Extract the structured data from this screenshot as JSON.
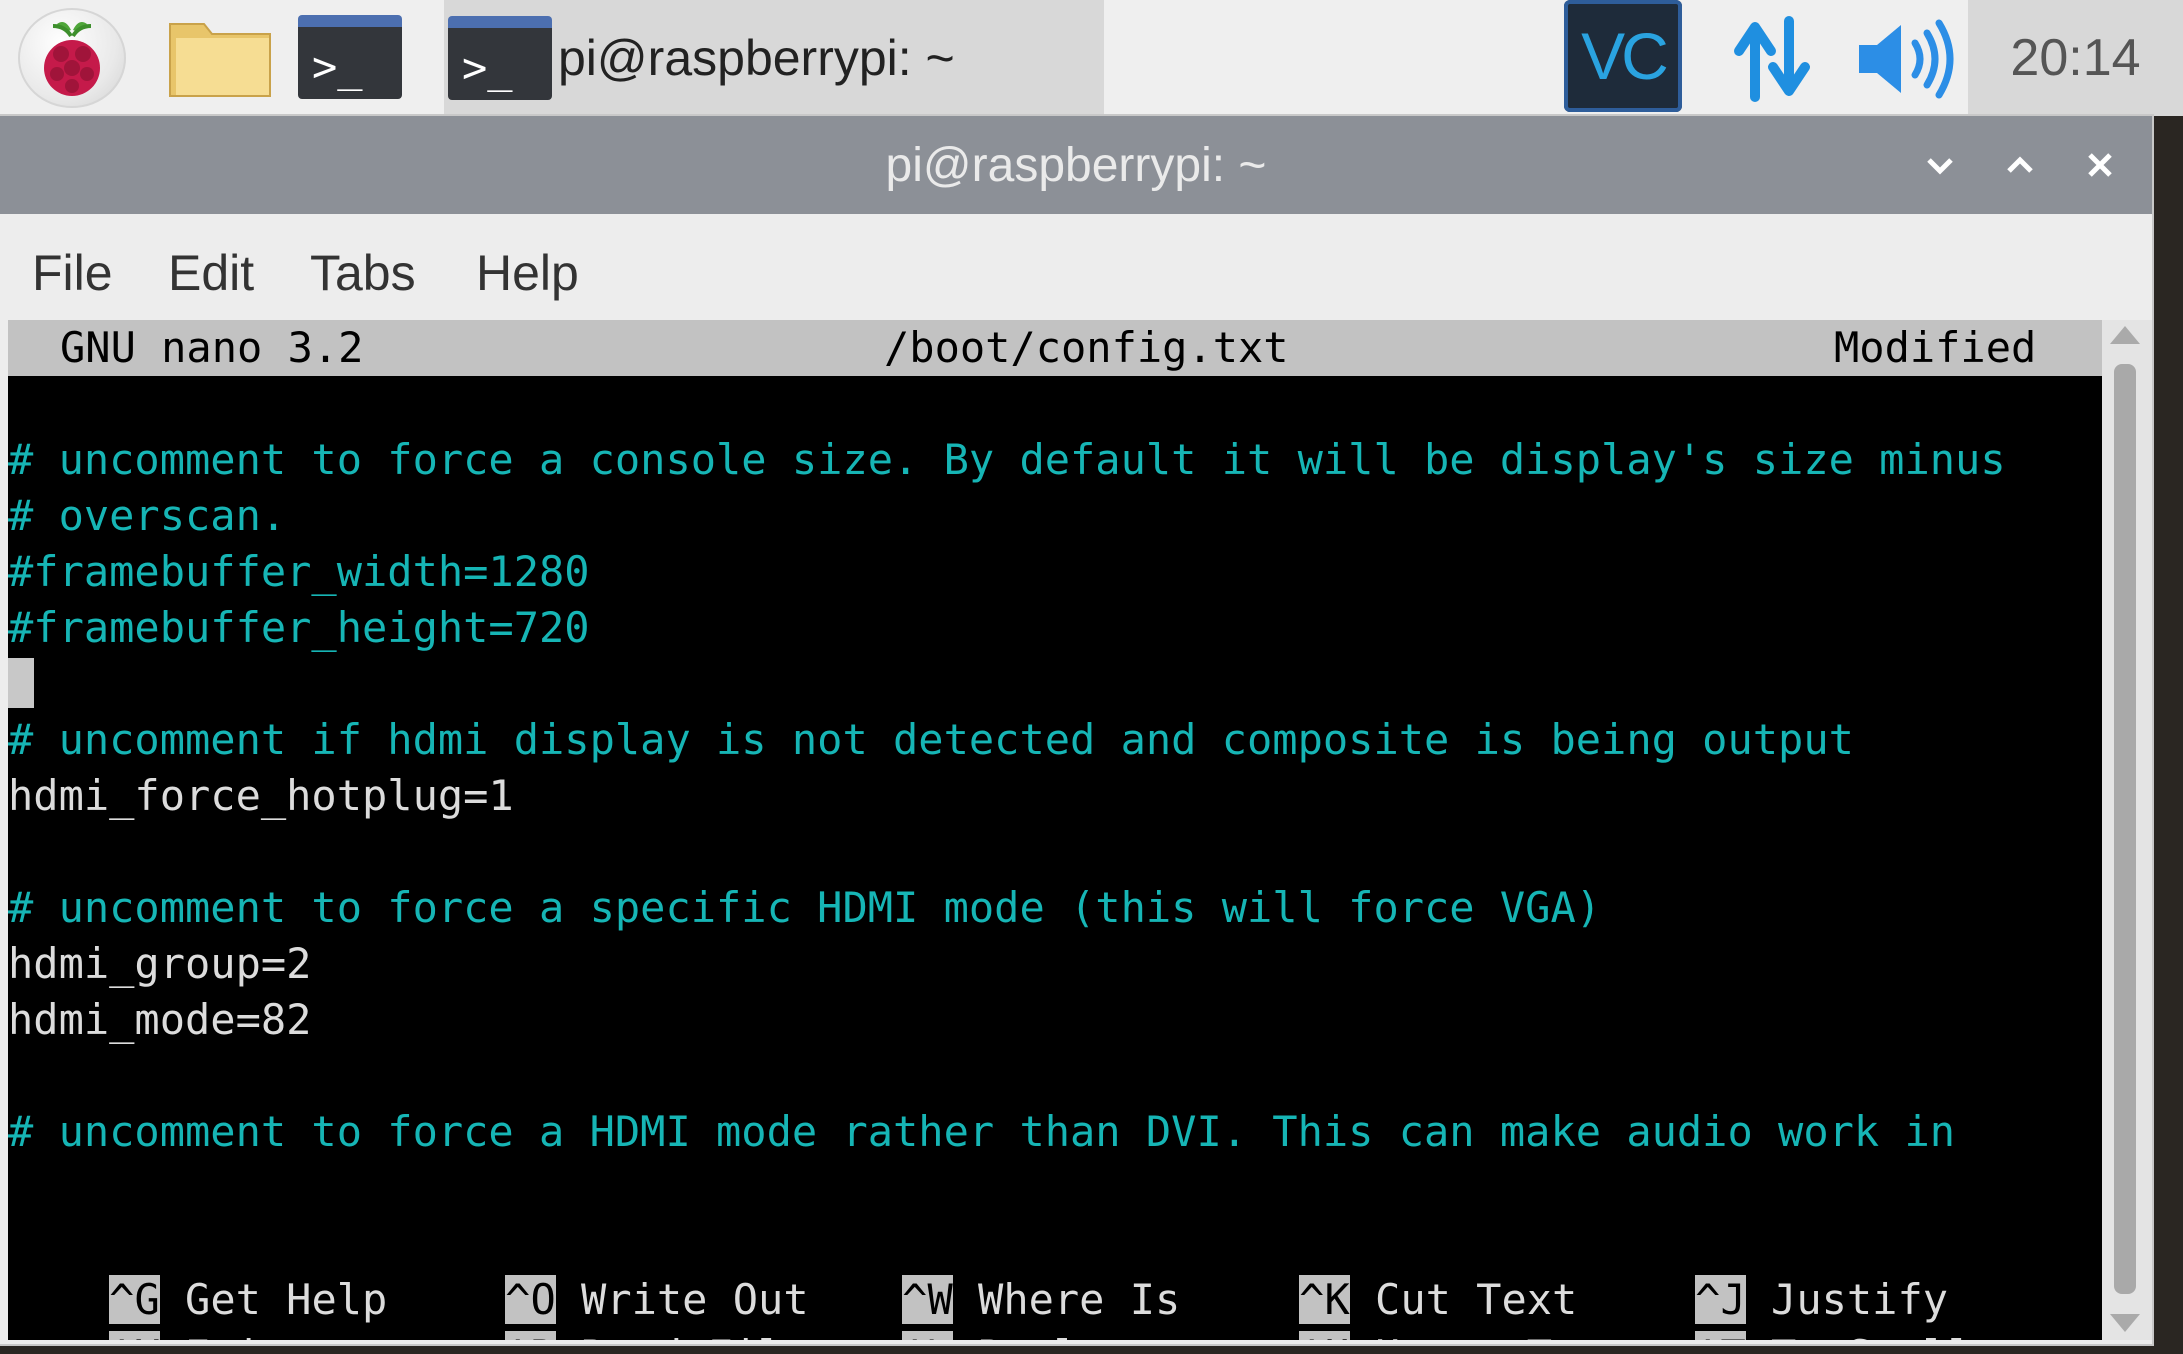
{
  "panel": {
    "icons": [
      "raspberry-menu-icon",
      "file-manager-icon",
      "terminal-icon",
      "vnc-icon",
      "network-icon",
      "volume-icon"
    ],
    "task_button_label": "pi@raspberrypi: ~",
    "terminal_icon_glyph": ">_",
    "vnc_glyph": "VC",
    "clock": "20:14"
  },
  "window": {
    "title": "pi@raspberrypi: ~",
    "menu": [
      "File",
      "Edit",
      "Tabs",
      "Help"
    ]
  },
  "nano": {
    "version": "GNU nano 3.2",
    "filename": "/boot/config.txt",
    "status": "Modified",
    "lines": [
      "# uncomment to force a console size. By default it will be display's size minus",
      "# overscan.",
      "#framebuffer_width=1280",
      "#framebuffer_height=720",
      "",
      "# uncomment if hdmi display is not detected and composite is being output",
      "hdmi_force_hotplug=1",
      "",
      "# uncomment to force a specific HDMI mode (this will force VGA)",
      "hdmi_group=2",
      "hdmi_mode=82",
      "",
      "# uncomment to force a HDMI mode rather than DVI. This can make audio work in"
    ],
    "shortcuts": [
      {
        "key": "^G",
        "label": "Get Help"
      },
      {
        "key": "^O",
        "label": "Write Out"
      },
      {
        "key": "^W",
        "label": "Where Is"
      },
      {
        "key": "^K",
        "label": "Cut Text"
      },
      {
        "key": "^J",
        "label": "Justify"
      },
      {
        "key": "^X",
        "label": "Exit"
      },
      {
        "key": "^R",
        "label": "Read File"
      },
      {
        "key": "^\\",
        "label": "Replace"
      },
      {
        "key": "^U",
        "label": "Uncut Text"
      },
      {
        "key": "^T",
        "label": "To Spell"
      }
    ]
  },
  "colors": {
    "comment": "#16b5b5",
    "text": "#dcdcdc",
    "titlebar": "#8c9097",
    "background": "#000000"
  }
}
